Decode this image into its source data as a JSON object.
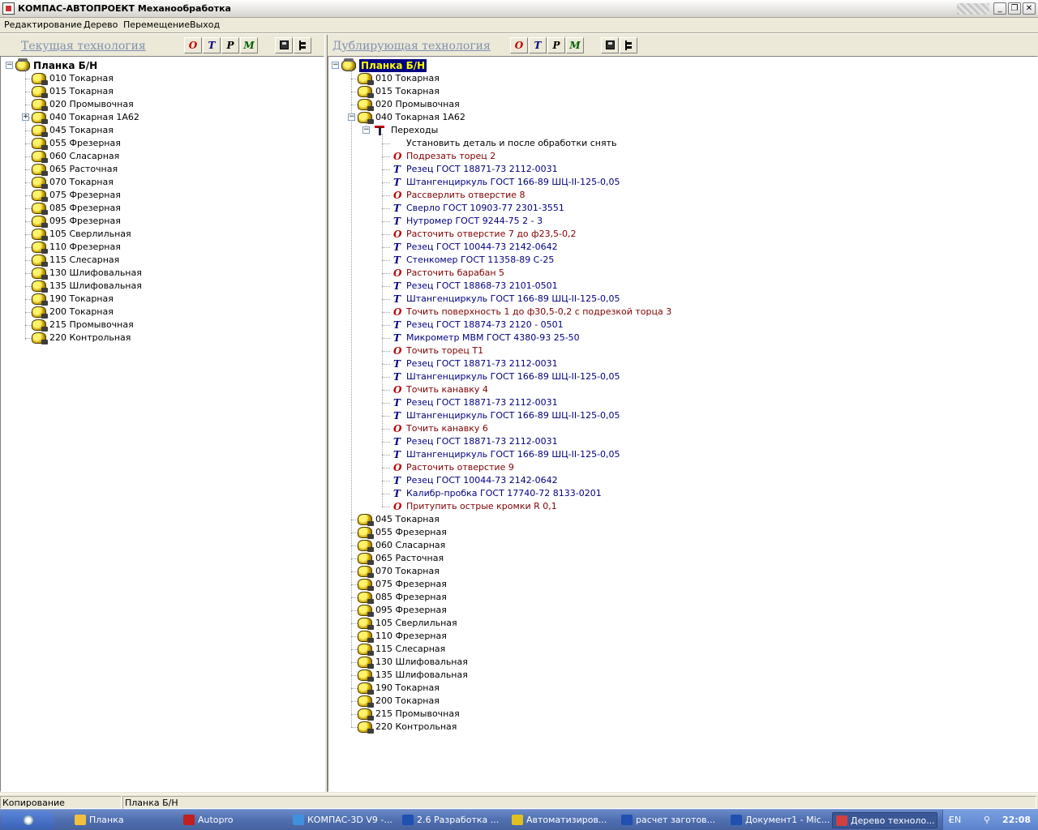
{
  "window": {
    "title": "КОМПАС-АВТОПРОЕКТ Механообработка",
    "min": "0",
    "max": "1",
    "close": "r"
  },
  "menu": [
    "Редактирование",
    "Дерево",
    "Перемещение",
    "Выход"
  ],
  "toolbar": {
    "btn_o": "О",
    "btn_t": "Т",
    "btn_p": "Р",
    "btn_m": "М"
  },
  "left_panel": {
    "title": "Текущая технология",
    "root": "Планка Б/Н",
    "ops": [
      "010 Токарная",
      "015 Токарная",
      "020 Промывочная",
      "040 Токарная 1А62",
      "045 Токарная",
      "055 Фрезерная",
      "060 Сласарная",
      "065 Расточная",
      "070 Токарная",
      "075 Фрезерная",
      "085 Фрезерная",
      "095 Фрезерная",
      "105 Сверлильная",
      "110 Фрезерная",
      "115 Слесарная",
      "130 Шлифовальная",
      "135 Шлифовальная",
      "190 Токарная",
      "200 Токарная",
      "215 Промывочная",
      "220 Контрольная"
    ]
  },
  "right_panel": {
    "title": "Дублирующая технология",
    "root": "Планка Б/Н",
    "ops_before": [
      "010 Токарная",
      "015 Токарная",
      "020 Промывочная"
    ],
    "expanded_op": "040 Токарная 1А62",
    "transitions_label": "Переходы",
    "steps": [
      {
        "t": "",
        "text": "Установить деталь и после обработки снять"
      },
      {
        "t": "О",
        "text": "Подрезать торец 2"
      },
      {
        "t": "Т",
        "text": "Резец     ГОСТ 18871-73 2112-0031"
      },
      {
        "t": "Т",
        "text": "Штангенциркуль ГОСТ 166-89 ШЦ-II-125-0,05"
      },
      {
        "t": "О",
        "text": "Рассверлить отверстие 8"
      },
      {
        "t": "Т",
        "text": "Сверло     ГОСТ 10903-77 2301-3551"
      },
      {
        "t": "Т",
        "text": "Нутромер  ГОСТ 9244-75 2 - 3"
      },
      {
        "t": "О",
        "text": "Расточить отверстие 7 до ф23,5-0,2"
      },
      {
        "t": "Т",
        "text": "Резец  ГОСТ 10044-73 2142-0642"
      },
      {
        "t": "Т",
        "text": "Стенкомер  ГОСТ 11358-89 С-25"
      },
      {
        "t": "О",
        "text": "Расточить барабан 5"
      },
      {
        "t": "Т",
        "text": "Резец    ГОСТ 18868-73 2101-0501"
      },
      {
        "t": "Т",
        "text": "Штангенциркуль ГОСТ 166-89 ШЦ-II-125-0,05"
      },
      {
        "t": "О",
        "text": "Точить поверхность 1 до ф30,5-0,2 с подрезкой торца 3"
      },
      {
        "t": "Т",
        "text": "Резец     ГОСТ 18874-73 2120 - 0501"
      },
      {
        "t": "Т",
        "text": "Микрометр  МВМ  ГОСТ 4380-93 25-50"
      },
      {
        "t": "О",
        "text": "Точить торец Т1"
      },
      {
        "t": "Т",
        "text": "Резец     ГОСТ 18871-73 2112-0031"
      },
      {
        "t": "Т",
        "text": "Штангенциркуль ГОСТ 166-89 ШЦ-II-125-0,05"
      },
      {
        "t": "О",
        "text": "Точить канавку 4"
      },
      {
        "t": "Т",
        "text": "Резец     ГОСТ 18871-73 2112-0031"
      },
      {
        "t": "Т",
        "text": "Штангенциркуль ГОСТ 166-89 ШЦ-II-125-0,05"
      },
      {
        "t": "О",
        "text": "Точить канавку 6"
      },
      {
        "t": "Т",
        "text": "Резец     ГОСТ 18871-73 2112-0031"
      },
      {
        "t": "Т",
        "text": "Штангенциркуль ГОСТ 166-89 ШЦ-II-125-0,05"
      },
      {
        "t": "О",
        "text": "Расточить отверстие 9"
      },
      {
        "t": "Т",
        "text": "Резец  ГОСТ 10044-73 2142-0642"
      },
      {
        "t": "Т",
        "text": "Калибр-пробка  ГОСТ 17740-72 8133-0201"
      },
      {
        "t": "О",
        "text": "Притупить острые кромки R 0,1"
      }
    ],
    "ops_after": [
      "045 Токарная",
      "055 Фрезерная",
      "060 Сласарная",
      "065 Расточная",
      "070 Токарная",
      "075 Фрезерная",
      "085 Фрезерная",
      "095 Фрезерная",
      "105 Сверлильная",
      "110 Фрезерная",
      "115 Слесарная",
      "130 Шлифовальная",
      "135 Шлифовальная",
      "190 Токарная",
      "200 Токарная",
      "215 Промывочная",
      "220 Контрольная"
    ]
  },
  "status": {
    "left": "Копирование",
    "right": "Планка Б/Н"
  },
  "taskbar": {
    "tasks": [
      {
        "label": "Планка",
        "icon": "folder-icon",
        "color": "#f0c040"
      },
      {
        "label": "Autopro",
        "icon": "autopro-icon",
        "color": "#c02020"
      },
      {
        "label": "КОМПАС-3D V9 -...",
        "icon": "kompas-icon",
        "color": "#4090e0"
      },
      {
        "label": "2.6 Разработка ...",
        "icon": "word-icon",
        "color": "#2050b0"
      },
      {
        "label": "Автоматизиров...",
        "icon": "help-icon",
        "color": "#e0c020"
      },
      {
        "label": "расчет заготов...",
        "icon": "word-icon",
        "color": "#2050b0"
      },
      {
        "label": "Документ1 - Mic...",
        "icon": "word-icon",
        "color": "#2050b0"
      },
      {
        "label": "Дерево техноло...",
        "icon": "app-icon",
        "color": "#d04040"
      }
    ],
    "lang": "EN",
    "clock": "22:08"
  }
}
